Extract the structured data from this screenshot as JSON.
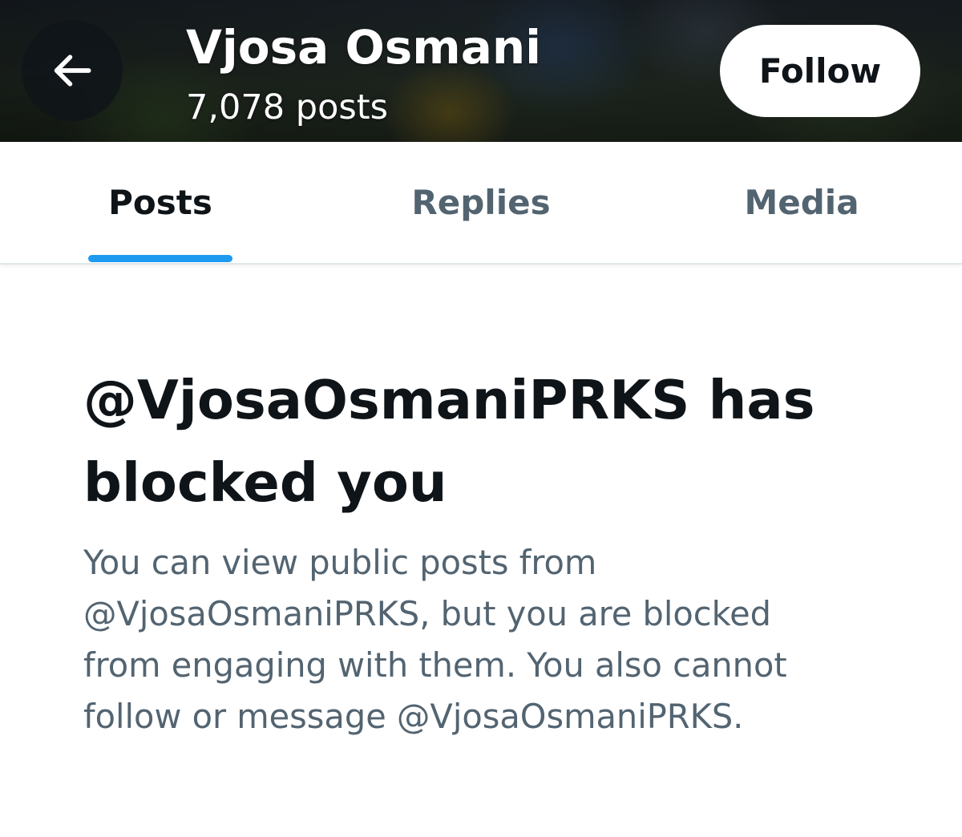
{
  "header": {
    "back_label": "Back",
    "profile_name": "Vjosa Osmani",
    "post_count": "7,078 posts",
    "follow_label": "Follow"
  },
  "tabs": [
    {
      "label": "Posts",
      "active": true
    },
    {
      "label": "Replies",
      "active": false
    },
    {
      "label": "Media",
      "active": false
    }
  ],
  "blocked": {
    "title": "@VjosaOsmaniPRKS has blocked you",
    "description": "You can view public posts from @VjosaOsmaniPRKS, but you are blocked from engaging with them. You also cannot follow or message @VjosaOsmaniPRKS."
  },
  "icons": {
    "back": "arrow-left-icon"
  },
  "colors": {
    "accent": "#1d9bf0",
    "primary_text": "#0f1419",
    "secondary_text": "#536471"
  }
}
